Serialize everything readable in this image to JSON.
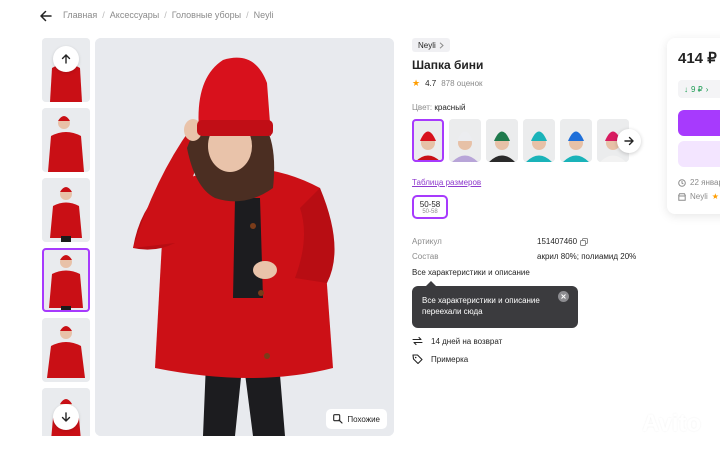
{
  "breadcrumbs": [
    "Главная",
    "Аксессуары",
    "Головные уборы",
    "Neyli"
  ],
  "brand": "Neyli",
  "product": {
    "title": "Шапка бини",
    "rating": "4.7",
    "reviews": "878 оценок"
  },
  "color": {
    "label": "Цвет:",
    "value": "красный"
  },
  "swatch_colors": [
    "#d8111c",
    "#b8a5d8",
    "#1f7a4d",
    "#1ab3b9",
    "#1e9bd9",
    "#d81b60"
  ],
  "size": {
    "table_link": "Таблица размеров",
    "selected": "50-58",
    "selected_sub": "50-58"
  },
  "specs": [
    {
      "key": "Артикул",
      "value": "151407460"
    },
    {
      "key": "Состав",
      "value": "акрил 80%; полиамид 20%"
    }
  ],
  "all_specs_link": "Все характеристики и описание",
  "tooltip": "Все характеристики и описание переехали сюда",
  "info_rows": [
    "14 дней на возврат",
    "Примерка"
  ],
  "price_card": {
    "price": "414 ₽",
    "sub": "9 ₽",
    "delivery": "22 январ",
    "seller": "Neyli"
  },
  "similar_button": "Похожие",
  "watermark": "Avito",
  "colors": {
    "accent": "#a73afd",
    "accent_light": "#f3e5ff",
    "sweater": "#cc1016"
  }
}
